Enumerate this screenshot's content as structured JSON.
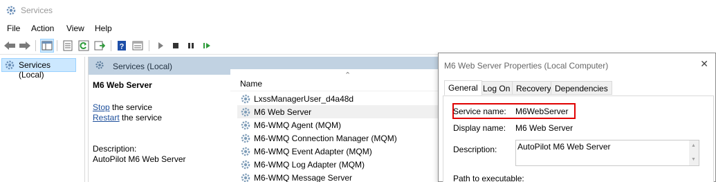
{
  "window": {
    "title": "Services"
  },
  "menu": [
    "File",
    "Action",
    "View",
    "Help"
  ],
  "tree": {
    "root_label": "Services (Local)"
  },
  "main": {
    "header_label": "Services (Local)",
    "detail": {
      "service_name": "M6 Web Server",
      "stop_link": "Stop",
      "stop_suffix": " the service",
      "restart_link": "Restart",
      "restart_suffix": " the service",
      "description_label": "Description:",
      "description_value": "AutoPilot M6 Web Server"
    },
    "list": {
      "column_name": "Name",
      "rows": [
        "LxssManagerUser_d4a48d",
        "M6 Web Server",
        "M6-WMQ Agent (MQM)",
        "M6-WMQ Connection Manager (MQM)",
        "M6-WMQ Event Adapter (MQM)",
        "M6-WMQ Log Adapter (MQM)",
        "M6-WMQ Message Server"
      ],
      "selected_index": 1
    }
  },
  "dialog": {
    "title": "M6 Web Server  Properties (Local Computer)",
    "close_glyph": "✕",
    "tabs": [
      "General",
      "Log On",
      "Recovery",
      "Dependencies"
    ],
    "active_tab": "General",
    "service_name_label": "Service name:",
    "service_name_value": "M6WebServer",
    "display_name_label": "Display name:",
    "display_name_value": "M6 Web Server",
    "description_label": "Description:",
    "description_value": "AutoPilot M6 Web Server",
    "path_label": "Path to executable:"
  },
  "colors": {
    "highlight_border": "#e00000",
    "header_bg": "#c1d2e2",
    "tree_selected_bg": "#cce8ff",
    "link": "#1d4f9b",
    "play_green": "#2e9b3a"
  },
  "icons": {
    "app": "gear-icon",
    "toolbar": [
      "back-arrow-icon",
      "forward-arrow-icon",
      "show-hide-tree-icon",
      "properties-sheet-icon",
      "refresh-icon",
      "export-list-icon",
      "help-icon",
      "console-view-icon",
      "play-icon",
      "stop-icon",
      "pause-icon",
      "resume-icon"
    ]
  }
}
